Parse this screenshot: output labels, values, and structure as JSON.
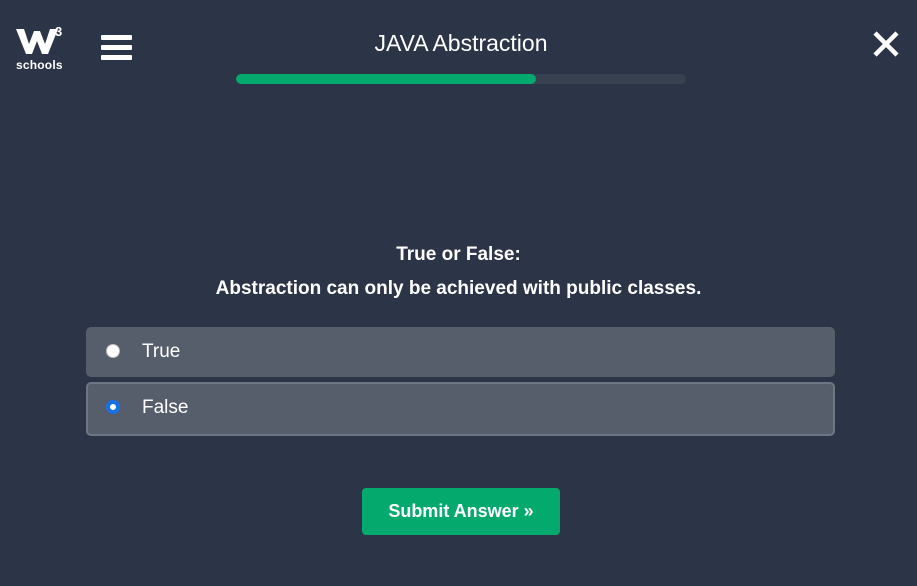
{
  "header": {
    "logo": {
      "superscript": "3",
      "text": "schools",
      "icon": "w3schools-logo"
    },
    "menu_icon": "hamburger-menu-icon",
    "title": "JAVA Abstraction",
    "progress": 0.667,
    "close_icon": "close-icon"
  },
  "question": {
    "line1": "True or False:",
    "line2": "Abstraction can only be achieved with public classes."
  },
  "options": [
    {
      "label": "True",
      "selected": false
    },
    {
      "label": "False",
      "selected": true
    }
  ],
  "submit": {
    "label": "Submit Answer »"
  },
  "colors": {
    "background": "#2c3547",
    "accent": "#04aa6d",
    "option_bg": "#565e6c",
    "radio_selected": "#1670e6"
  }
}
